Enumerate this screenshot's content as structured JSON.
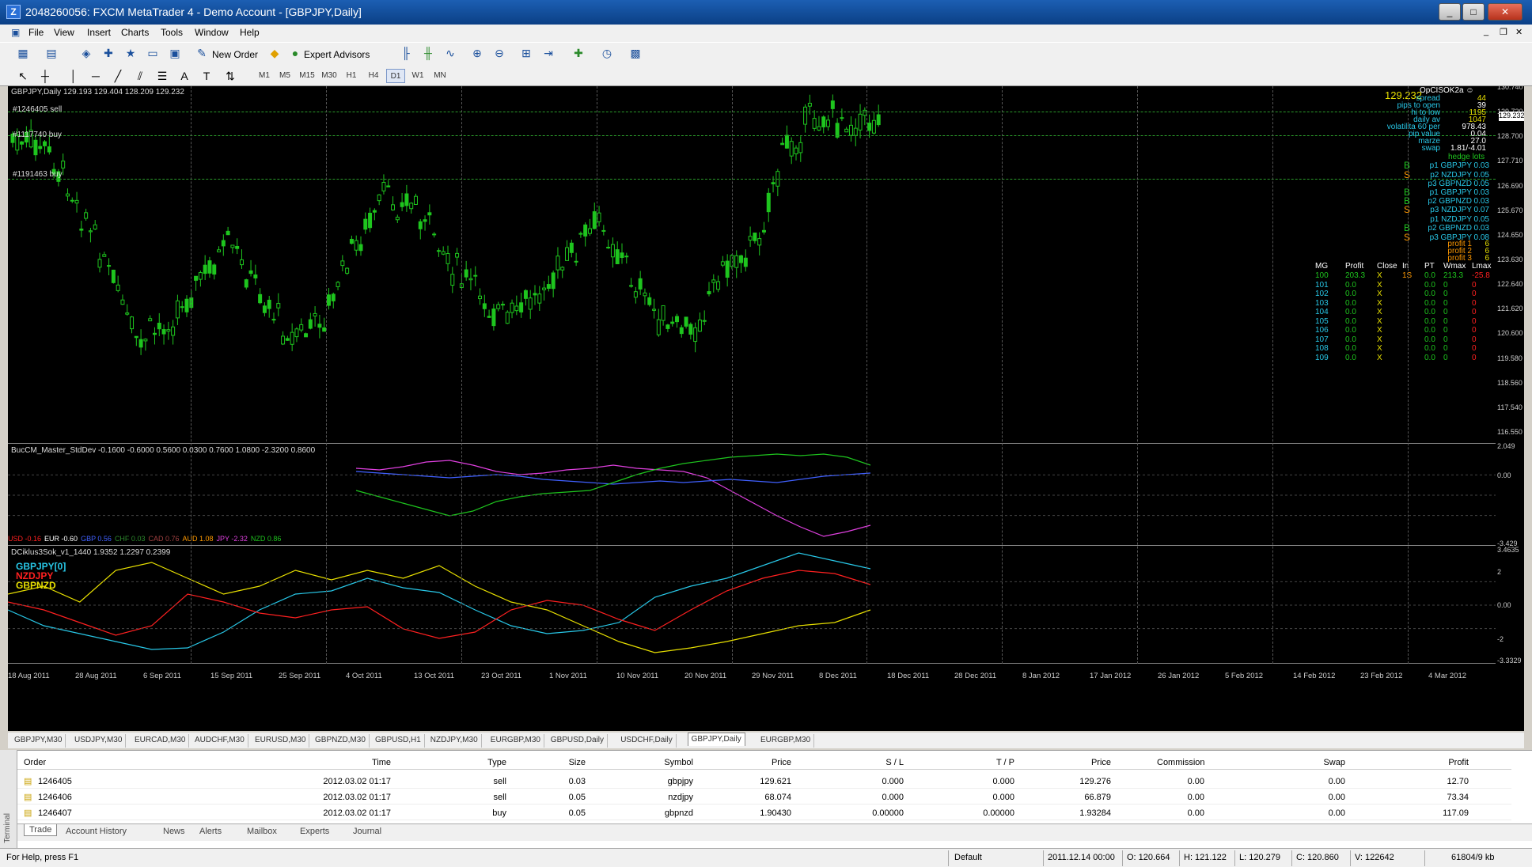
{
  "window": {
    "title": "2048260056: FXCM MetaTrader 4 - Demo Account - [GBPJPY,Daily]"
  },
  "menu": [
    "File",
    "View",
    "Insert",
    "Charts",
    "Tools",
    "Window",
    "Help"
  ],
  "toolbar": {
    "new_order": "New Order",
    "expert_advisors": "Expert Advisors"
  },
  "timeframes": [
    "M1",
    "M5",
    "M15",
    "M30",
    "H1",
    "H4",
    "D1",
    "W1",
    "MN"
  ],
  "chart": {
    "symbol_label": "GBPJPY,Daily  129.193 129.404 128.209 129.232",
    "price_big": "129.232",
    "orders": [
      "#1246405 sell",
      "#1117740 buy",
      "#1191463 buy"
    ],
    "price_axis": [
      "130.740",
      "129.720",
      "128.700",
      "127.710",
      "126.690",
      "125.670",
      "124.650",
      "123.630",
      "122.640",
      "121.620",
      "120.600",
      "119.580",
      "118.560",
      "117.540",
      "116.550"
    ],
    "price_tag": "129.232",
    "date_axis": [
      "18 Aug 2011",
      "28 Aug 2011",
      "6 Sep 2011",
      "15 Sep 2011",
      "25 Sep 2011",
      "4 Oct 2011",
      "13 Oct 2011",
      "23 Oct 2011",
      "1 Nov 2011",
      "10 Nov 2011",
      "20 Nov 2011",
      "29 Nov 2011",
      "8 Dec 2011",
      "18 Dec 2011",
      "28 Dec 2011",
      "8 Jan 2012",
      "17 Jan 2012",
      "26 Jan 2012",
      "5 Feb 2012",
      "14 Feb 2012",
      "23 Feb 2012",
      "4 Mar 2012"
    ],
    "info_panel": {
      "title": "OpCISOK2a ☺",
      "rows": [
        [
          "spread",
          "44"
        ],
        [
          "pips to open",
          "39"
        ],
        [
          "hi to low",
          "1195"
        ],
        [
          "daily av",
          "1047"
        ],
        [
          "volatilita 60 per",
          "978.43"
        ],
        [
          "pip value",
          "0.04"
        ],
        [
          "marze",
          "27.0"
        ],
        [
          "swap",
          "1.81/-4.01"
        ]
      ],
      "hedge_title": "hedge lots",
      "hedge": [
        [
          "B",
          "p1 GBPJPY",
          "0.03"
        ],
        [
          "S",
          "p2 NZDJPY",
          "0.05"
        ],
        [
          "",
          "p3 GBPNZD",
          "0.05"
        ],
        [
          "B",
          "p1 GBPJPY",
          "0.03"
        ],
        [
          "B",
          "p2 GBPNZD",
          "0.03"
        ],
        [
          "S",
          "p3 NZDJPY",
          "0.07"
        ],
        [
          "",
          "p1 NZDJPY",
          "0.05"
        ],
        [
          "B",
          "p2 GBPNZD",
          "0.03"
        ],
        [
          "S",
          "p3 GBPJPY",
          "0.08"
        ]
      ],
      "profits": [
        [
          "profit 1",
          "6"
        ],
        [
          "profit 2",
          "6"
        ],
        [
          "profit 3",
          "6"
        ]
      ],
      "mg_headers": [
        "MG",
        "Profit",
        "Close",
        "In",
        "PT",
        "Wmax",
        "Lmax"
      ],
      "mg_rows": [
        [
          "100",
          "203.3",
          "X",
          "1S",
          "0.0",
          "213.3",
          "-25.8"
        ],
        [
          "101",
          "0.0",
          "X",
          "",
          "0.0",
          "0",
          "0"
        ],
        [
          "102",
          "0.0",
          "X",
          "",
          "0.0",
          "0",
          "0"
        ],
        [
          "103",
          "0.0",
          "X",
          "",
          "0.0",
          "0",
          "0"
        ],
        [
          "104",
          "0.0",
          "X",
          "",
          "0.0",
          "0",
          "0"
        ],
        [
          "105",
          "0.0",
          "X",
          "",
          "0.0",
          "0",
          "0"
        ],
        [
          "106",
          "0.0",
          "X",
          "",
          "0.0",
          "0",
          "0"
        ],
        [
          "107",
          "0.0",
          "X",
          "",
          "0.0",
          "0",
          "0"
        ],
        [
          "108",
          "0.0",
          "X",
          "",
          "0.0",
          "0",
          "0"
        ],
        [
          "109",
          "0.0",
          "X",
          "",
          "0.0",
          "0",
          "0"
        ]
      ]
    },
    "ind1": {
      "label": "BucCM_Master_StdDev -0.1600 -0.6000 0.5600 0.0300 0.7600 1.0800 -2.3200 0.8600",
      "axis": [
        "2.049",
        "0.00",
        "-3.429"
      ],
      "legend": [
        [
          "USD -0.16",
          "#ff2020"
        ],
        [
          "EUR -0.60",
          "#ffffff"
        ],
        [
          "GBP 0.56",
          "#4060ff"
        ],
        [
          "CHF 0.03",
          "#2e8b2e"
        ],
        [
          "CAD 0.76",
          "#a04040"
        ],
        [
          "AUD 1.08",
          "#ff9900"
        ],
        [
          "JPY -2.32",
          "#e040e0"
        ],
        [
          "NZD 0.86",
          "#1ec51e"
        ]
      ]
    },
    "ind2": {
      "label": "DCiklus3Sok_v1_1440 1.9352 1.2297 0.2399",
      "axis": [
        "3.4635",
        "2",
        "0.00",
        "-2",
        "-3.3329"
      ],
      "series": [
        "GBPJPY[0]",
        "NZDJPY",
        "GBPNZD"
      ]
    }
  },
  "chart_tabs": [
    "GBPJPY,M30",
    "USDJPY,M30",
    "EURCAD,M30",
    "AUDCHF,M30",
    "EURUSD,M30",
    "GBPNZD,M30",
    "GBPUSD,H1",
    "NZDJPY,M30",
    "EURGBP,M30",
    "GBPUSD,Daily",
    "USDCHF,Daily",
    "GBPJPY,Daily",
    "EURGBP,M30"
  ],
  "terminal": {
    "headers": [
      "Order",
      "Time",
      "Type",
      "Size",
      "Symbol",
      "Price",
      "S / L",
      "T / P",
      "Price",
      "Commission",
      "Swap",
      "Profit"
    ],
    "rows": [
      [
        "1246405",
        "2012.03.02 01:17",
        "sell",
        "0.03",
        "gbpjpy",
        "129.621",
        "0.000",
        "0.000",
        "129.276",
        "0.00",
        "0.00",
        "12.70"
      ],
      [
        "1246406",
        "2012.03.02 01:17",
        "sell",
        "0.05",
        "nzdjpy",
        "68.074",
        "0.000",
        "0.000",
        "66.879",
        "0.00",
        "0.00",
        "73.34"
      ],
      [
        "1246407",
        "2012.03.02 01:17",
        "buy",
        "0.05",
        "gbpnzd",
        "1.90430",
        "0.00000",
        "0.00000",
        "1.93284",
        "0.00",
        "0.00",
        "117.09"
      ]
    ],
    "tabs": [
      "Trade",
      "Account History",
      "News",
      "Alerts",
      "Mailbox",
      "Experts",
      "Journal"
    ],
    "side_label": "Terminal"
  },
  "status": {
    "help": "For Help, press F1",
    "profile": "Default",
    "time": "2011.12.14 00:00",
    "open": "O: 120.664",
    "high": "H: 121.122",
    "low": "L: 120.279",
    "close": "C: 120.860",
    "vol": "V: 122642",
    "traffic": "61804/9 kb"
  }
}
